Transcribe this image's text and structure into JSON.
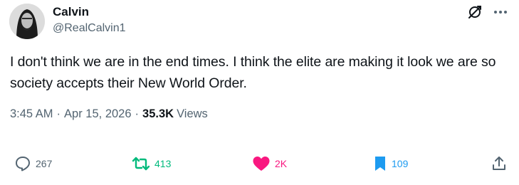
{
  "author": {
    "name": "Calvin",
    "handle": "@RealCalvin1"
  },
  "tweet": {
    "text": "I don't think we are in the end times. I think the elite are making it look we are so society accepts their New World Order."
  },
  "meta": {
    "time": "3:45 AM",
    "separator": "·",
    "date": "Apr 15, 2026",
    "views_count": "35.3K",
    "views_label": "Views"
  },
  "actions": {
    "replies": "267",
    "reposts": "413",
    "likes": "2K",
    "bookmarks": "109"
  },
  "colors": {
    "text": "#0f1419",
    "muted": "#536471",
    "repost": "#00ba7c",
    "like": "#f91880",
    "bookmark": "#1d9bf0"
  },
  "icons": {
    "top": [
      "grok-icon",
      "more-icon"
    ],
    "actions": [
      "reply-icon",
      "repost-icon",
      "like-icon",
      "bookmark-icon",
      "share-icon"
    ]
  }
}
